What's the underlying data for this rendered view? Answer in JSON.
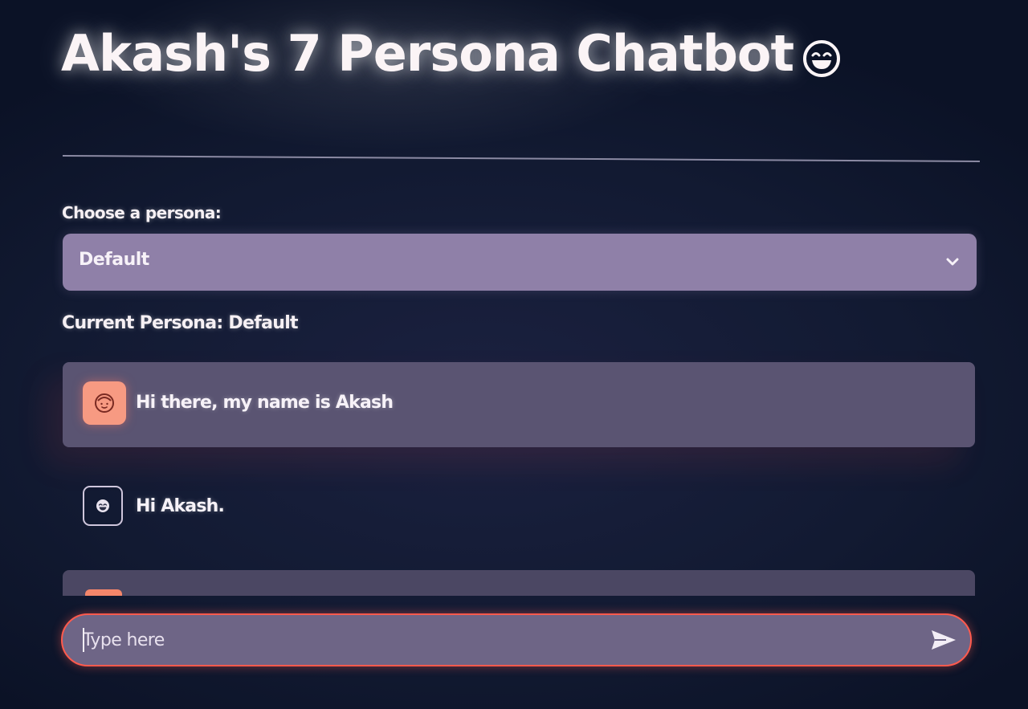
{
  "header": {
    "title": "Akash's 7 Persona Chatbot",
    "title_icon": "grinning-face-emoji-icon"
  },
  "persona": {
    "label": "Choose a persona:",
    "selected": "Default",
    "current_label": "Current Persona: Default"
  },
  "messages": [
    {
      "role": "user",
      "avatar": "user-face-icon",
      "text": "Hi there, my name is Akash"
    },
    {
      "role": "assistant",
      "avatar": "bot-face-icon",
      "text": "Hi Akash."
    }
  ],
  "chat_input": {
    "placeholder": "Type here",
    "send_icon": "send-icon"
  },
  "colors": {
    "background": "#121a32",
    "select_bg": "#8f80a8",
    "user_bubble": "#5a5472",
    "user_avatar": "#f79a82",
    "input_border": "#ff5a4d"
  }
}
